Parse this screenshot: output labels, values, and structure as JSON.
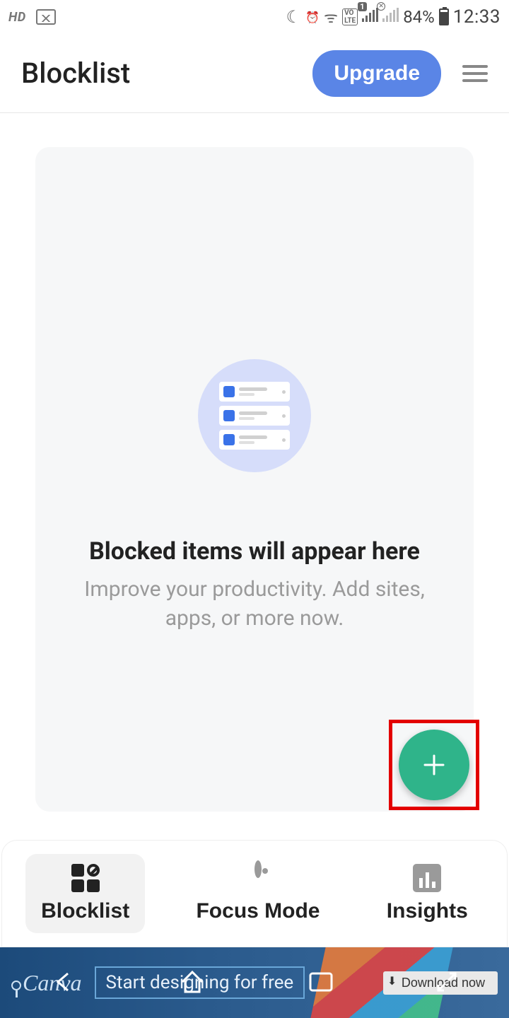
{
  "status": {
    "hd": "HD",
    "battery_pct": "84%",
    "time": "12:33",
    "sim_badge": "1"
  },
  "header": {
    "title": "Blocklist",
    "upgrade_label": "Upgrade"
  },
  "empty_state": {
    "title": "Blocked items will appear here",
    "subtitle": "Improve your productivity. Add sites, apps, or more now."
  },
  "nav": {
    "items": [
      {
        "label": "Blocklist",
        "active": true
      },
      {
        "label": "Focus Mode",
        "active": false
      },
      {
        "label": "Insights",
        "active": false
      }
    ]
  },
  "ad": {
    "brand": "Canva",
    "tagline": "Start designing for free",
    "cta": "Download now"
  }
}
